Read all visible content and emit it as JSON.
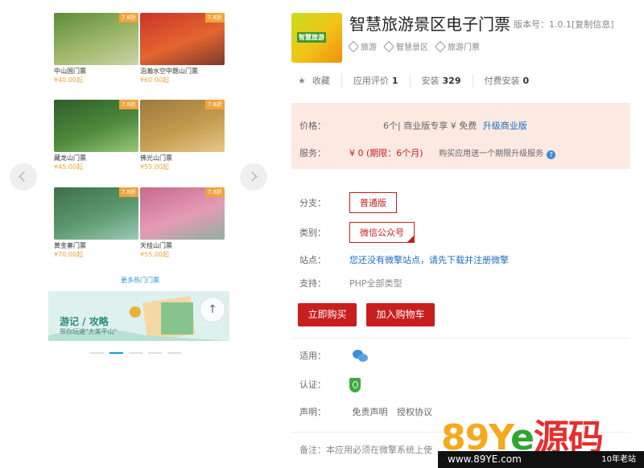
{
  "preview": {
    "cards": [
      {
        "name": "中山国门票",
        "price": "¥40.00起",
        "badge": "7.8折",
        "colors": [
          "#5e8a3a",
          "#9fb86a",
          "#c9d4a8"
        ]
      },
      {
        "name": "泊瀚水空中题山门票",
        "price": "¥60.00起",
        "badge": "7.8折",
        "colors": [
          "#c9342a",
          "#e4652f",
          "#7a3a2c"
        ]
      },
      {
        "name": "藏龙山门票",
        "price": "¥45.00起",
        "badge": "7.8折",
        "colors": [
          "#2f5d2a",
          "#4e8a3d",
          "#9bc77a"
        ]
      },
      {
        "name": "佛光山门票",
        "price": "¥55.00起",
        "badge": "7.8折",
        "colors": [
          "#9c7a3f",
          "#c49c4e",
          "#e6c78b"
        ]
      },
      {
        "name": "黄金寨门票",
        "price": "¥70.00起",
        "badge": "7.8折",
        "colors": [
          "#3e6f4a",
          "#5c9a6f",
          "#9dc9b6"
        ]
      },
      {
        "name": "天桂山门票",
        "price": "¥55.00起",
        "badge": "7.8折",
        "colors": [
          "#c66a8e",
          "#e59bb5",
          "#8fb0a0"
        ]
      }
    ],
    "more_link": "更多热门门票",
    "banner_title": "游记 / 攻略",
    "banner_sub": "带你玩遍\"大美平山\"",
    "up_arrow": "↑"
  },
  "app": {
    "logo_text": "智慧旅游",
    "title": "智慧旅游景区电子门票",
    "version": "版本号：1.0.1[复制信息]",
    "tags": [
      "旅游",
      "智慧景区",
      "旅游门票"
    ],
    "stats": {
      "favorite": "收藏",
      "rating_label": "应用评价",
      "rating_value": "1",
      "installs_label": "安装",
      "installs_value": "329",
      "paid_label": "付费安装",
      "paid_value": "0"
    }
  },
  "pricing": {
    "price_label": "价格：",
    "price_value": "6个| 商业版专享 ¥ 免费",
    "upgrade_link": "升级商业版",
    "service_label": "服务：",
    "service_value": "¥ 0 (期限：6个月)",
    "service_note": "购买应用送一个期限升级服务",
    "help": "?"
  },
  "options": {
    "branch_label": "分支：",
    "branch_value": "普通版",
    "category_label": "类别：",
    "category_value": "微信公众号",
    "site_label": "站点：",
    "site_value": "您还没有微擎站点，请先下载并注册微擎",
    "support_label": "支持：",
    "support_value": "PHP全部类型"
  },
  "actions": {
    "buy": "立即购买",
    "cart": "加入购物车"
  },
  "meta": {
    "apply_label": "适用：",
    "cert_label": "认证：",
    "statement_label": "声明：",
    "disclaimer": "免责声明",
    "license": "授权协议",
    "note": "备注：本应用必须在微擎系统上使"
  },
  "watermark": {
    "big_a": "89Y",
    "big_b": "e",
    "big_c": "源码",
    "url": "www.89YE.com",
    "slogan": "10年老站"
  }
}
